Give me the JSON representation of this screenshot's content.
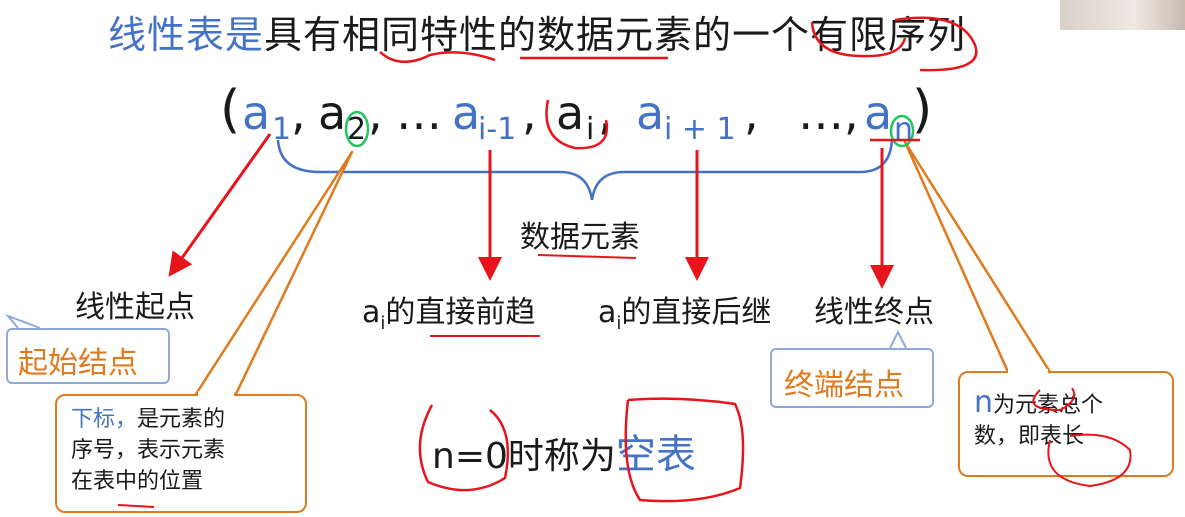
{
  "title": {
    "part1": "线性表是",
    "part2": "具有相同特性的数据元素的一个有限序列"
  },
  "sequence": {
    "open_paren": "(",
    "a1": "a",
    "a1_sub": "1",
    "sep1": ",",
    "a2": "a",
    "a2_sub": "2",
    "sep2": ",",
    "dots1": "…",
    "ai_minus": "a",
    "ai_minus_sub": "i-1",
    "sep3": ",",
    "ai": "a",
    "ai_sub": "i",
    "sep4": ",",
    "ai_plus": "a",
    "ai_plus_sub": "i + 1",
    "sep5": ",",
    "dots2": "…,",
    "an": "a",
    "an_sub": "n",
    "close_paren": ")"
  },
  "labels": {
    "data_elements": "数据元素",
    "linear_start": "线性起点",
    "start_node": "起始结点",
    "pred_prefix": "a",
    "pred_sub": "i",
    "pred_text": "的直接前趋",
    "succ_prefix": "a",
    "succ_sub": "i",
    "succ_text": "的直接后继",
    "linear_end": "线性终点",
    "end_node": "终端结点"
  },
  "notes": {
    "subscript_blue": "下标，",
    "subscript_rest1": "是元素的",
    "subscript_line2": "序号，表示元素",
    "subscript_line3": "在表中的位置",
    "n_symbol": "n",
    "n_line1": "为元素总个",
    "n_line2": "数，即表长"
  },
  "empty": {
    "prefix": "n=0时称为",
    "highlight": "空表"
  },
  "colors": {
    "blue": "#4472c4",
    "red": "#e8141b",
    "orange": "#e07a1f",
    "green": "#22c55e",
    "box_blue": "#8eaadb"
  }
}
